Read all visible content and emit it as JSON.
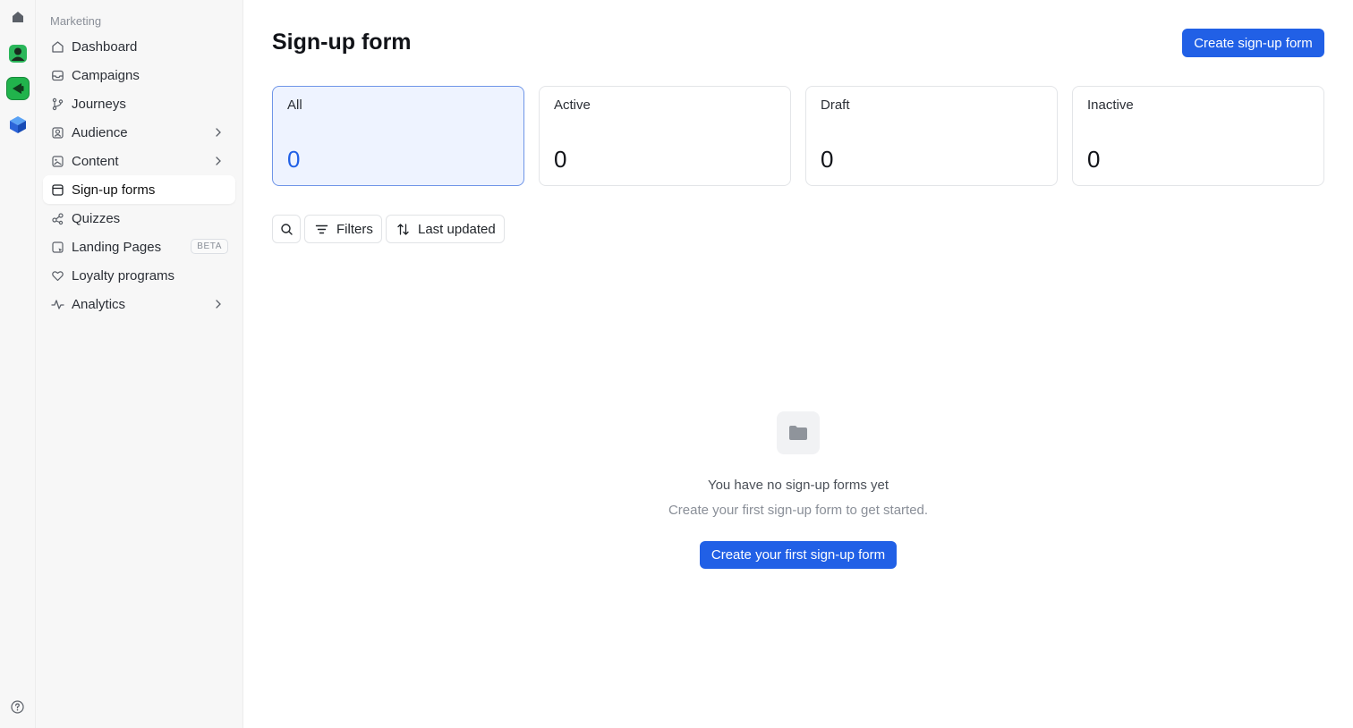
{
  "sidebar": {
    "section_label": "Marketing",
    "items": [
      {
        "label": "Dashboard",
        "icon": "house-icon"
      },
      {
        "label": "Campaigns",
        "icon": "inbox-icon"
      },
      {
        "label": "Journeys",
        "icon": "branch-icon"
      },
      {
        "label": "Audience",
        "icon": "users-icon",
        "has_submenu": true
      },
      {
        "label": "Content",
        "icon": "image-icon",
        "has_submenu": true
      },
      {
        "label": "Sign-up forms",
        "icon": "form-icon",
        "active": true
      },
      {
        "label": "Quizzes",
        "icon": "quiz-icon"
      },
      {
        "label": "Landing Pages",
        "icon": "page-icon",
        "badge": "BETA"
      },
      {
        "label": "Loyalty programs",
        "icon": "heart-icon"
      },
      {
        "label": "Analytics",
        "icon": "pulse-icon",
        "has_submenu": true
      }
    ]
  },
  "header": {
    "title": "Sign-up form",
    "create_button": "Create sign-up form"
  },
  "stats": [
    {
      "label": "All",
      "value": "0",
      "selected": true
    },
    {
      "label": "Active",
      "value": "0"
    },
    {
      "label": "Draft",
      "value": "0"
    },
    {
      "label": "Inactive",
      "value": "0"
    }
  ],
  "toolbar": {
    "filters_label": "Filters",
    "sort_label": "Last updated"
  },
  "empty_state": {
    "title": "You have no sign-up forms yet",
    "subtitle": "Create your first sign-up form to get started.",
    "button": "Create your first sign-up form"
  },
  "colors": {
    "primary": "#2160e6",
    "selected_card_bg": "#eef3ff",
    "app_green": "#21b34c"
  }
}
